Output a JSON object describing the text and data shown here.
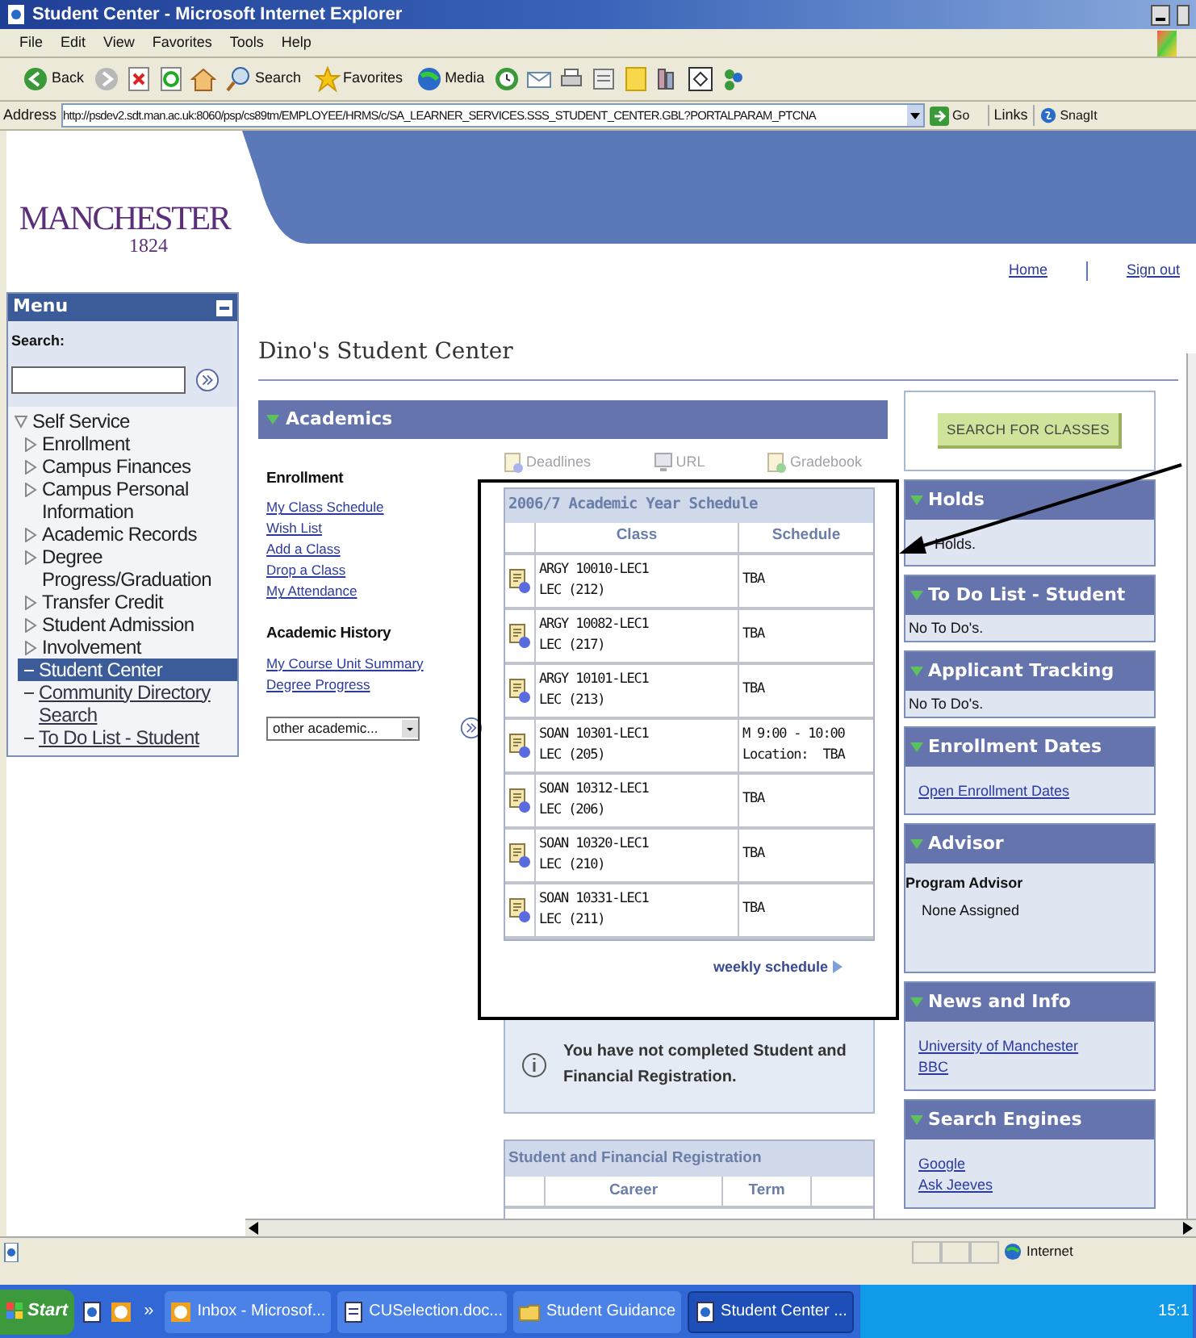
{
  "window": {
    "title": "Student Center - Microsoft Internet Explorer"
  },
  "menu_bar": [
    "File",
    "Edit",
    "View",
    "Favorites",
    "Tools",
    "Help"
  ],
  "toolbar": [
    {
      "kind": "back",
      "label": "Back"
    },
    {
      "kind": "forward"
    },
    {
      "kind": "stop"
    },
    {
      "kind": "refresh"
    },
    {
      "kind": "home"
    },
    {
      "kind": "search",
      "label": "Search"
    },
    {
      "kind": "favorites",
      "label": "Favorites"
    },
    {
      "kind": "media",
      "label": "Media"
    },
    {
      "kind": "history"
    },
    {
      "kind": "mail"
    },
    {
      "kind": "print"
    },
    {
      "kind": "edit"
    },
    {
      "kind": "note"
    },
    {
      "kind": "research"
    },
    {
      "kind": "code"
    },
    {
      "kind": "messenger"
    }
  ],
  "address_bar": {
    "label": "Address",
    "url": "http://psdev2.sdt.man.ac.uk:8060/psp/cs89tm/EMPLOYEE/HRMS/c/SA_LEARNER_SERVICES.SSS_STUDENT_CENTER.GBL?PORTALPARAM_PTCNA",
    "go": "Go",
    "links": "Links",
    "snagit": "SnagIt"
  },
  "logo": {
    "name": "MANCHESTER",
    "year": "1824"
  },
  "header_links": [
    "Home",
    "Sign out"
  ],
  "sidebar": {
    "title": "Menu",
    "search_label": "Search:",
    "tree": [
      {
        "label": "Self Service",
        "kind": "folder",
        "expanded": true,
        "selected": false,
        "children": [
          {
            "label": "Enrollment",
            "kind": "folder",
            "expanded": false,
            "selected": false
          },
          {
            "label": "Campus Finances",
            "kind": "folder",
            "expanded": false,
            "selected": false
          },
          {
            "label": "Campus Personal Information",
            "kind": "folder",
            "expanded": false,
            "selected": false
          },
          {
            "label": "Academic Records",
            "kind": "folder",
            "expanded": false,
            "selected": false
          },
          {
            "label": "Degree Progress/Graduation",
            "kind": "folder",
            "expanded": false,
            "selected": false
          },
          {
            "label": "Transfer Credit",
            "kind": "folder",
            "expanded": false,
            "selected": false
          },
          {
            "label": "Student Admission",
            "kind": "folder",
            "expanded": false,
            "selected": false
          },
          {
            "label": "Involvement",
            "kind": "folder",
            "expanded": false,
            "selected": false
          },
          {
            "label": "Student Center",
            "kind": "page",
            "selected": true
          },
          {
            "label": "Community Directory Search",
            "kind": "page",
            "selected": false
          },
          {
            "label": "To Do List - Student",
            "kind": "page",
            "selected": false
          }
        ]
      }
    ]
  },
  "page_title": "Dino's Student Center",
  "academics": {
    "title": "Academics",
    "expanded": true,
    "sections": [
      {
        "heading": "Enrollment",
        "links": [
          "My Class Schedule",
          "Wish List",
          "Add a Class",
          "Drop a Class",
          "My Attendance"
        ]
      },
      {
        "heading": "Academic History",
        "links": [
          "My Course Unit Summary",
          "Degree Progress"
        ]
      }
    ],
    "dropdown": "other academic...",
    "quick_links": [
      {
        "kind": "deadlines",
        "label": "Deadlines"
      },
      {
        "kind": "url",
        "label": "URL"
      },
      {
        "kind": "gradebook",
        "label": "Gradebook"
      }
    ],
    "schedule": {
      "title": "2006/7 Academic Year Schedule",
      "columns": [
        "Class",
        "Schedule"
      ],
      "rows": [
        {
          "class": "ARGY 10010-LEC1",
          "section": "LEC (212)",
          "schedule": [
            "TBA"
          ]
        },
        {
          "class": "ARGY 10082-LEC1",
          "section": "LEC (217)",
          "schedule": [
            "TBA"
          ]
        },
        {
          "class": "ARGY 10101-LEC1",
          "section": "LEC (213)",
          "schedule": [
            "TBA"
          ]
        },
        {
          "class": "SOAN 10301-LEC1",
          "section": "LEC (205)",
          "schedule": [
            "M 9:00 - 10:00",
            "Location:  TBA"
          ]
        },
        {
          "class": "SOAN 10312-LEC1",
          "section": "LEC (206)",
          "schedule": [
            "TBA"
          ]
        },
        {
          "class": "SOAN 10320-LEC1",
          "section": "LEC (210)",
          "schedule": [
            "TBA"
          ]
        },
        {
          "class": "SOAN 10331-LEC1",
          "section": "LEC (211)",
          "schedule": [
            "TBA"
          ]
        }
      ],
      "link": "weekly schedule"
    },
    "notice": "You have not completed Student and Financial Registration.",
    "registration": {
      "title": "Student and Financial Registration",
      "columns": [
        "Career",
        "Term"
      ]
    }
  },
  "search_button": "SEARCH FOR CLASSES",
  "panels": [
    {
      "title": "Holds",
      "expanded": true,
      "items": [
        {
          "kind": "partial",
          "text": "Holds."
        }
      ]
    },
    {
      "title": "To Do List - Student",
      "expanded": true,
      "items": [
        {
          "kind": "text",
          "text": "No To Do's."
        }
      ]
    },
    {
      "title": "Applicant Tracking",
      "expanded": true,
      "items": [
        {
          "kind": "text",
          "text": "No To Do's."
        }
      ]
    },
    {
      "title": "Enrollment Dates",
      "expanded": true,
      "items": [
        {
          "kind": "link",
          "text": "Open Enrollment Dates"
        }
      ]
    },
    {
      "title": "Advisor",
      "expanded": true,
      "items": [
        {
          "kind": "heading",
          "text": "Program Advisor"
        },
        {
          "kind": "indent",
          "text": "None Assigned"
        }
      ]
    },
    {
      "title": "News and Info",
      "expanded": true,
      "items": [
        {
          "kind": "link",
          "text": "University of Manchester"
        },
        {
          "kind": "link",
          "text": "BBC"
        }
      ]
    },
    {
      "title": "Search Engines",
      "expanded": true,
      "items": [
        {
          "kind": "link",
          "text": "Google"
        },
        {
          "kind": "link",
          "text": "Ask Jeeves"
        }
      ]
    }
  ],
  "status_bar": {
    "zone": "Internet"
  },
  "taskbar": {
    "start": "Start",
    "more": "»",
    "tasks": [
      {
        "kind": "mail",
        "label": "Inbox - Microsof...",
        "selected": false
      },
      {
        "kind": "doc",
        "label": "CUSelection.doc...",
        "selected": false
      },
      {
        "kind": "folder",
        "label": "Student Guidance",
        "selected": false
      },
      {
        "kind": "ie",
        "label": "Student Center ...",
        "selected": true
      }
    ],
    "clock": "15:1"
  }
}
